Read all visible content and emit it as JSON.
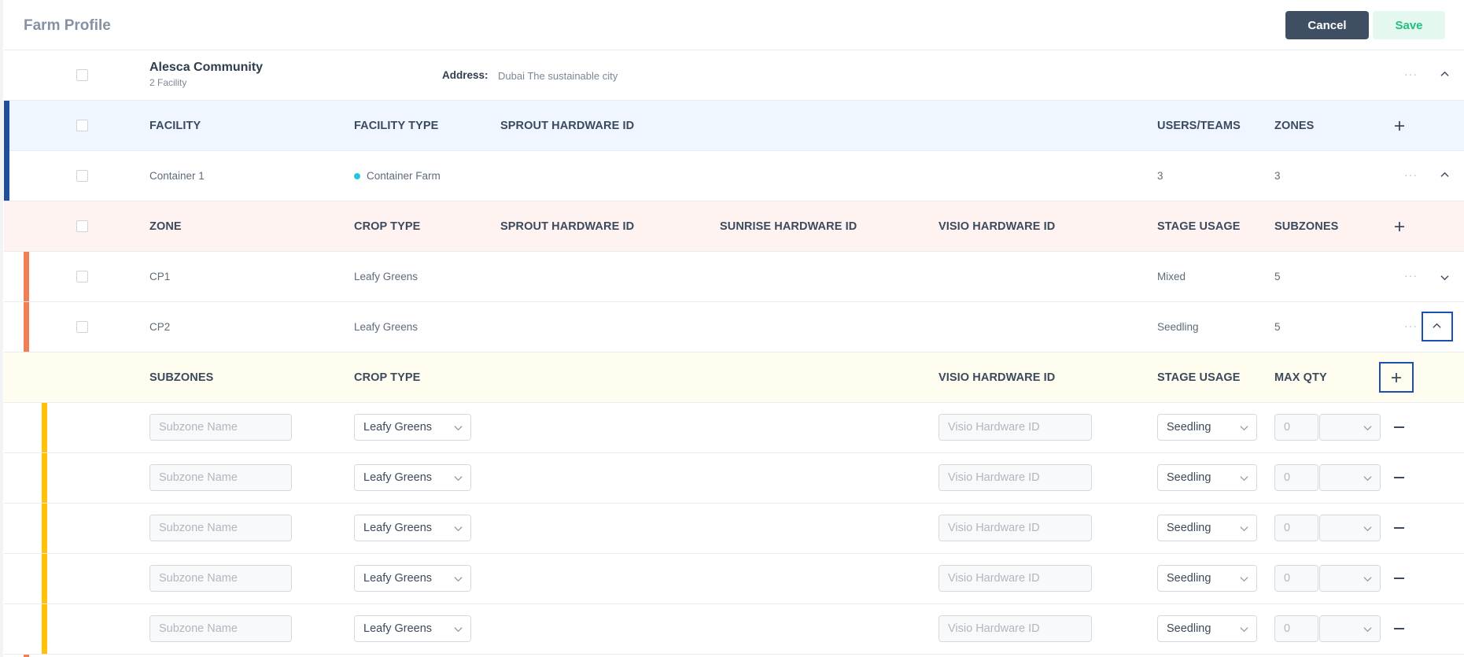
{
  "header": {
    "title": "Farm Profile",
    "cancel_label": "Cancel",
    "save_label": "Save"
  },
  "community": {
    "name": "Alesca Community",
    "facility_count": "2 Facility",
    "address_label": "Address:",
    "address_value": "Dubai The sustainable city",
    "more": "···"
  },
  "facility_header": {
    "facility": "FACILITY",
    "facility_type": "FACILITY TYPE",
    "sprout_hw": "SPROUT HARDWARE ID",
    "users_teams": "USERS/TEAMS",
    "zones": "ZONES"
  },
  "facility_row": {
    "name": "Container 1",
    "type": "Container Farm",
    "users": "3",
    "zones": "3",
    "more": "···",
    "type_dot_color": "#26c6da"
  },
  "zone_header": {
    "zone": "ZONE",
    "crop_type": "CROP TYPE",
    "sprout_hw": "SPROUT HARDWARE ID",
    "sunrise_hw": "SUNRISE HARDWARE ID",
    "visio_hw": "VISIO HARDWARE ID",
    "stage_usage": "STAGE USAGE",
    "subzones": "SUBZONES"
  },
  "zones": [
    {
      "name": "CP1",
      "crop": "Leafy Greens",
      "stage": "Mixed",
      "subzones": "5",
      "more": "···"
    },
    {
      "name": "CP2",
      "crop": "Leafy Greens",
      "stage": "Seedling",
      "subzones": "5",
      "more": "···"
    }
  ],
  "subzone_header": {
    "subzones": "SUBZONES",
    "crop_type": "CROP TYPE",
    "visio_hw": "VISIO HARDWARE ID",
    "stage_usage": "STAGE USAGE",
    "max_qty": "MAX QTY"
  },
  "subzone_rows": [
    {
      "name_placeholder": "Subzone Name",
      "crop": "Leafy Greens",
      "visio_placeholder": "Visio Hardware ID",
      "stage": "Seedling",
      "qty": "0"
    },
    {
      "name_placeholder": "Subzone Name",
      "crop": "Leafy Greens",
      "visio_placeholder": "Visio Hardware ID",
      "stage": "Seedling",
      "qty": "0"
    },
    {
      "name_placeholder": "Subzone Name",
      "crop": "Leafy Greens",
      "visio_placeholder": "Visio Hardware ID",
      "stage": "Seedling",
      "qty": "0"
    },
    {
      "name_placeholder": "Subzone Name",
      "crop": "Leafy Greens",
      "visio_placeholder": "Visio Hardware ID",
      "stage": "Seedling",
      "qty": "0"
    },
    {
      "name_placeholder": "Subzone Name",
      "crop": "Leafy Greens",
      "visio_placeholder": "Visio Hardware ID",
      "stage": "Seedling",
      "qty": "0"
    }
  ],
  "colors": {
    "facility_bar": "#1f4e9c",
    "zone_bar": "#f07f55",
    "subzone_bar": "#ffc107",
    "facility_header_bg": "#eff6ff",
    "zone_header_bg": "#fff3f1",
    "subzone_header_bg": "#fffcf0",
    "cancel_bg": "#3f4f63",
    "save_bg": "#e5f8ef",
    "save_text": "#22c07e",
    "focus": "#1a4fb4"
  }
}
